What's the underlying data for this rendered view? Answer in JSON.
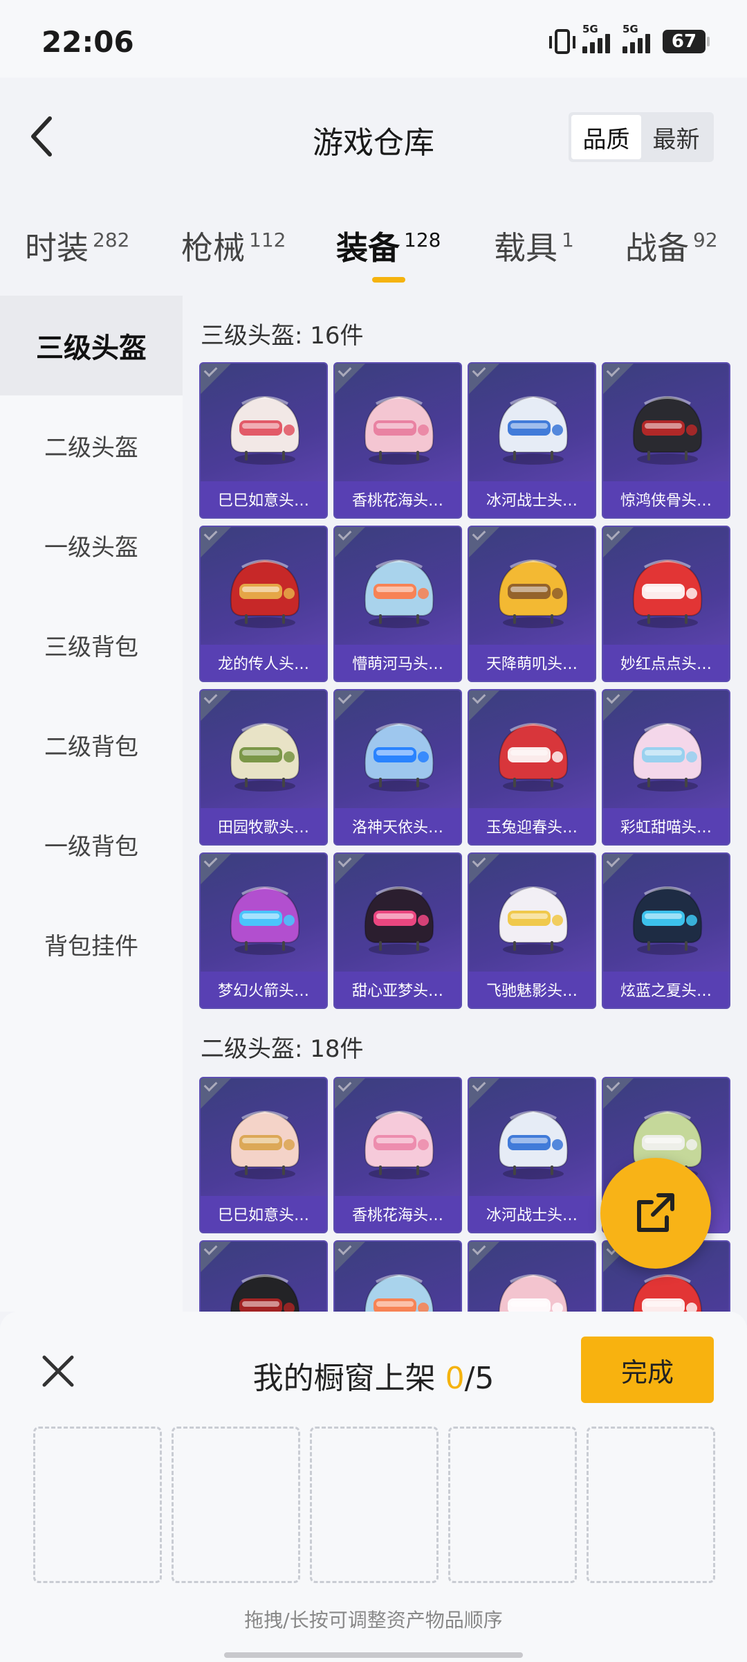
{
  "status": {
    "time": "22:06",
    "net1": "5G",
    "net2": "5G",
    "battery": "67"
  },
  "header": {
    "title": "游戏仓库",
    "sort_options": [
      "品质",
      "最新"
    ],
    "sort_active": 0
  },
  "tabs": [
    {
      "label": "时装",
      "count": "282"
    },
    {
      "label": "枪械",
      "count": "112"
    },
    {
      "label": "装备",
      "count": "128",
      "active": true
    },
    {
      "label": "载具",
      "count": "1"
    },
    {
      "label": "战备",
      "count": "92"
    }
  ],
  "sidebar": [
    "三级头盔",
    "二级头盔",
    "一级头盔",
    "三级背包",
    "二级背包",
    "一级背包",
    "背包挂件"
  ],
  "sections": [
    {
      "title": "三级头盔: 16件",
      "items": [
        {
          "name": "巳巳如意头…",
          "color": "#f2e8e6",
          "accent": "#e04a5a"
        },
        {
          "name": "香桃花海头…",
          "color": "#f4c6d2",
          "accent": "#e87a9c"
        },
        {
          "name": "冰河战士头…",
          "color": "#e6ecf6",
          "accent": "#2f6fd6"
        },
        {
          "name": "惊鸿侠骨头…",
          "color": "#2a2a30",
          "accent": "#c02828"
        },
        {
          "name": "龙的传人头…",
          "color": "#c72828",
          "accent": "#e8b44a"
        },
        {
          "name": "懵萌河马头…",
          "color": "#a9d3ec",
          "accent": "#ff7a45"
        },
        {
          "name": "天降萌叽头…",
          "color": "#f3b933",
          "accent": "#8a5a2a"
        },
        {
          "name": "妙红点点头…",
          "color": "#e23535",
          "accent": "#ffffff"
        },
        {
          "name": "田园牧歌头…",
          "color": "#e8e3c6",
          "accent": "#6f8e3a"
        },
        {
          "name": "洛神天依头…",
          "color": "#9ec7ee",
          "accent": "#1d7bff"
        },
        {
          "name": "玉兔迎春头…",
          "color": "#d8363b",
          "accent": "#ffffff"
        },
        {
          "name": "彩虹甜喵头…",
          "color": "#f4d7ea",
          "accent": "#8fd0f0"
        },
        {
          "name": "梦幻火箭头…",
          "color": "#b24fcf",
          "accent": "#3ed0ff"
        },
        {
          "name": "甜心亚梦头…",
          "color": "#2b1e2f",
          "accent": "#ff4a8a"
        },
        {
          "name": "飞驰魅影头…",
          "color": "#f2eff5",
          "accent": "#f0c43a"
        },
        {
          "name": "炫蓝之夏头…",
          "color": "#1e2c44",
          "accent": "#3fd2ff"
        }
      ]
    },
    {
      "title": "二级头盔: 18件",
      "items": [
        {
          "name": "巳巳如意头…",
          "color": "#f4d3c8",
          "accent": "#d9a34a"
        },
        {
          "name": "香桃花海头…",
          "color": "#f6cada",
          "accent": "#ec86a8"
        },
        {
          "name": "冰河战士头…",
          "color": "#e6ecf6",
          "accent": "#2f6fd6"
        },
        {
          "name": "",
          "color": "#c5d89a",
          "accent": "#f2f2f2"
        },
        {
          "name": "",
          "color": "#232326",
          "accent": "#b02424"
        },
        {
          "name": "",
          "color": "#a9d3ec",
          "accent": "#ff7a45"
        },
        {
          "name": "",
          "color": "#f3c4cf",
          "accent": "#ffffff"
        },
        {
          "name": "",
          "color": "#e23535",
          "accent": "#ffffff"
        }
      ]
    }
  ],
  "sheet": {
    "title_prefix": "我的橱窗上架",
    "count": "0",
    "total": "/5",
    "done": "完成",
    "hint": "拖拽/长按可调整资产物品顺序"
  }
}
